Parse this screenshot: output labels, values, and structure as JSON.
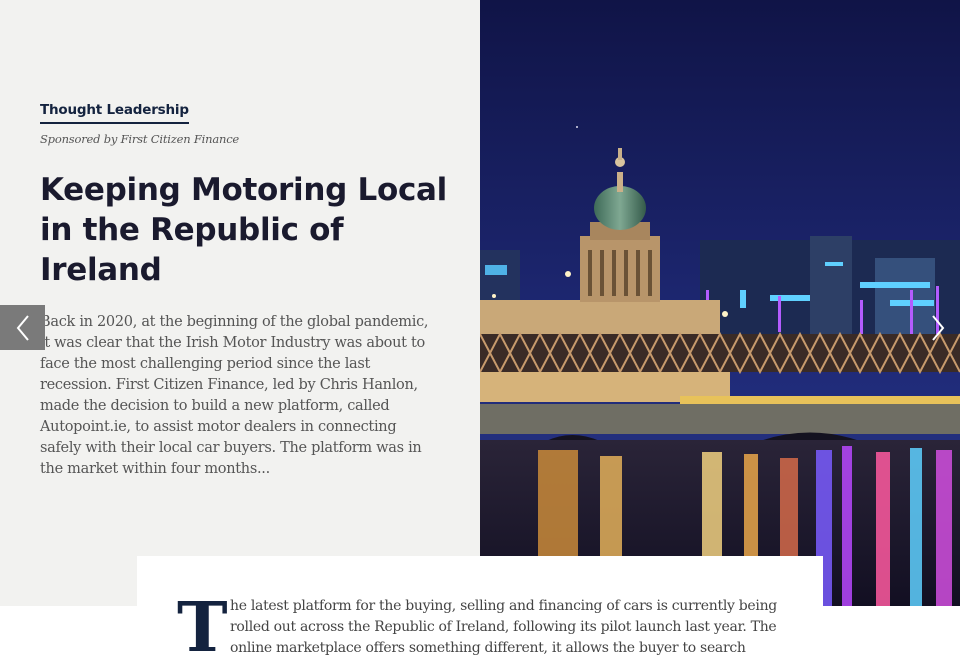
{
  "article": {
    "category": "Thought Leadership",
    "sponsor": "Sponsored by First Citizen Finance",
    "headline": "Keeping Motoring Local in the Republic of Ireland",
    "excerpt": "Back in 2020, at the beginning of the global pandemic, it was clear that the Irish Motor Industry was about to face the most challenging period since the last recession. First Citizen Finance, led by Chris Hanlon, made the decision to build a new platform, called Autopoint.ie, to assist motor dealers in connecting safely with their local car buyers. The platform was in the market within four months...",
    "dropcap": "T",
    "body": "he latest platform for the buying, selling and financing of cars is currently being rolled out across the Republic of Ireland, following its pilot launch last year. The online marketplace offers something different, it allows the buyer to search online"
  },
  "carousel": {
    "prev_icon": "chevron-left-icon",
    "next_icon": "chevron-right-icon"
  },
  "colors": {
    "accent": "#14233f",
    "panel_bg": "#f2f2f0",
    "headline": "#1a1a2e",
    "body_text": "#555555"
  }
}
